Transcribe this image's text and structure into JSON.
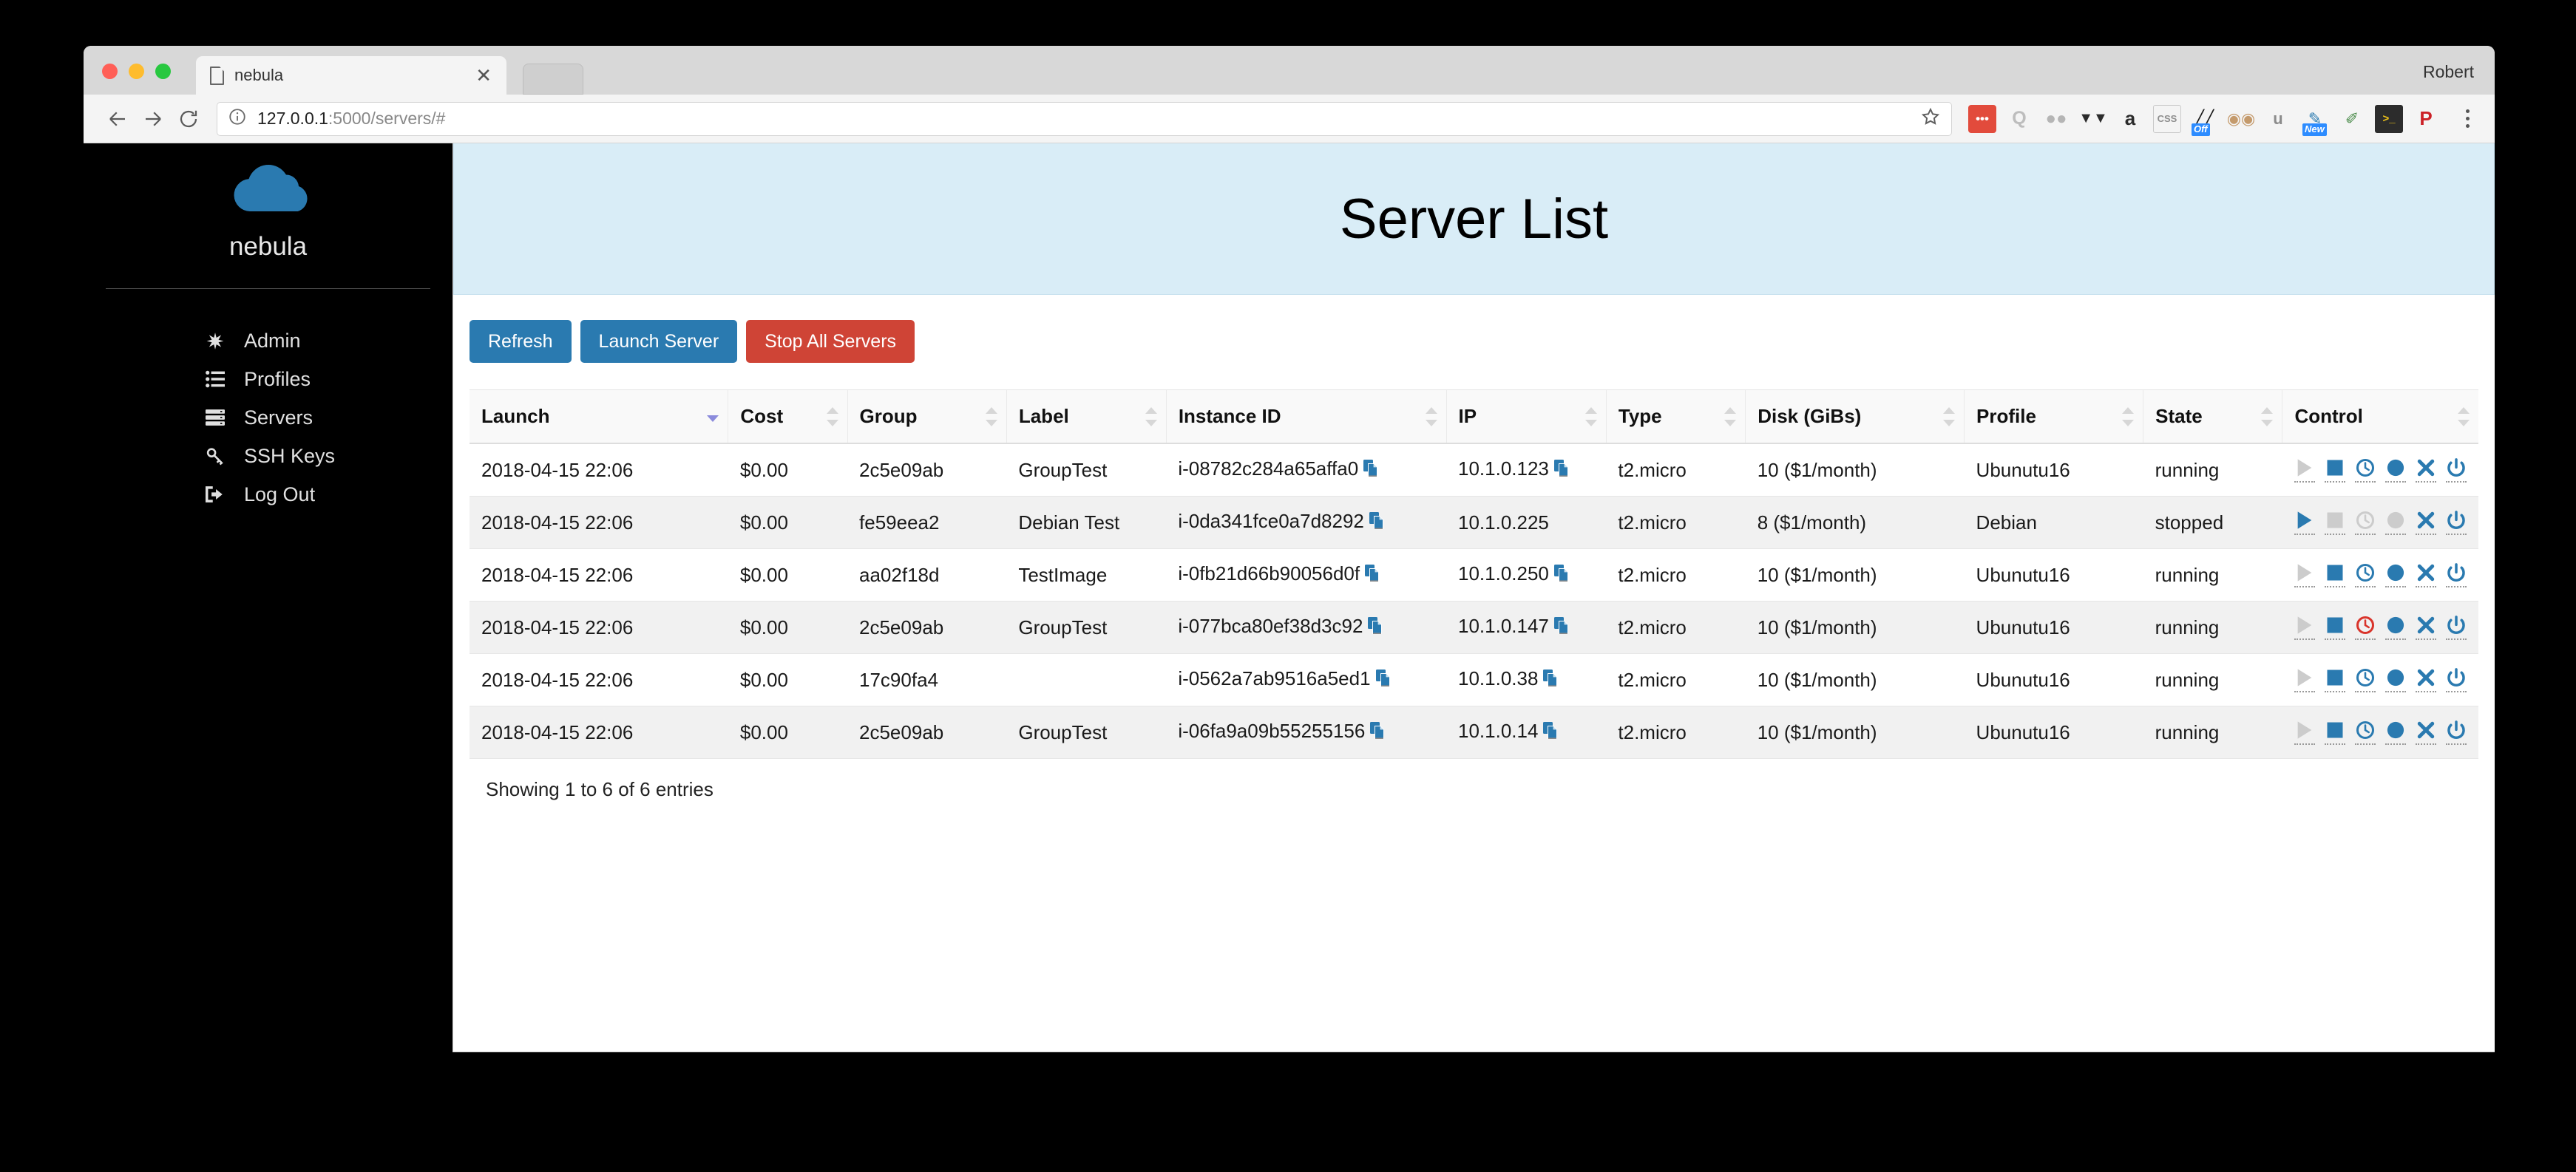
{
  "window": {
    "user_label": "Robert",
    "tab": {
      "title": "nebula",
      "favicon_icon": "document-icon",
      "close_icon": "close-icon"
    },
    "new_tab_icon": "new-tab-icon"
  },
  "toolbar": {
    "back_icon": "back-arrow-icon",
    "forward_icon": "forward-arrow-icon",
    "reload_icon": "reload-icon",
    "info_icon": "page-info-icon",
    "bookmark_icon": "star-icon",
    "menu_icon": "kebab-menu-icon",
    "url_host": "127.0.0.1",
    "url_path": ":5000/servers/#",
    "extensions": [
      {
        "name": "pocket-extension-icon",
        "glyph": "•••",
        "bg": "#e24b3c",
        "fg": "#ffffff",
        "badge": ""
      },
      {
        "name": "quantcast-extension-icon",
        "glyph": "Q",
        "bg": "transparent",
        "fg": "#bdbdbd",
        "badge": ""
      },
      {
        "name": "ghostery-extension-icon",
        "glyph": "●●",
        "bg": "transparent",
        "fg": "#b5b5b5",
        "badge": ""
      },
      {
        "name": "disconnect-extension-icon",
        "glyph": "◄►",
        "bg": "transparent",
        "fg": "#2b2b2b",
        "badge": ""
      },
      {
        "name": "amazon-extension-icon",
        "glyph": "a",
        "bg": "transparent",
        "fg": "#2b2b2b",
        "badge": ""
      },
      {
        "name": "css-extension-icon",
        "glyph": "CSS",
        "bg": "transparent",
        "fg": "#8f8f8f",
        "badge": ""
      },
      {
        "name": "script-blocker-extension-icon",
        "glyph": "╱╱",
        "bg": "transparent",
        "fg": "#1a1a1a",
        "badge": "Off"
      },
      {
        "name": "privacy-badger-extension-icon",
        "glyph": "●●",
        "bg": "transparent",
        "fg": "#c49a6c",
        "badge": ""
      },
      {
        "name": "ublock-extension-icon",
        "glyph": "u",
        "bg": "transparent",
        "fg": "#8b8b8b",
        "badge": ""
      },
      {
        "name": "evernote-extension-icon",
        "glyph": "✒",
        "bg": "transparent",
        "fg": "#2a7ab0",
        "badge": "New"
      },
      {
        "name": "colorpicker-extension-icon",
        "glyph": "✐",
        "bg": "transparent",
        "fg": "#4a8b4a",
        "badge": ""
      },
      {
        "name": "terminal-extension-icon",
        "glyph": ">_",
        "bg": "#2c2c2c",
        "fg": "#f0c419",
        "badge": ""
      },
      {
        "name": "pinterest-extension-icon",
        "glyph": "P",
        "bg": "transparent",
        "fg": "#cc2127",
        "badge": ""
      }
    ]
  },
  "sidebar": {
    "logo_icon": "cloud-logo-icon",
    "brand": "nebula",
    "items": [
      {
        "label": "Admin",
        "icon": "asterisk-icon"
      },
      {
        "label": "Profiles",
        "icon": "list-icon"
      },
      {
        "label": "Servers",
        "icon": "server-icon"
      },
      {
        "label": "SSH Keys",
        "icon": "key-icon"
      },
      {
        "label": "Log Out",
        "icon": "sign-out-icon"
      }
    ]
  },
  "main": {
    "page_title": "Server List",
    "buttons": [
      {
        "label": "Refresh",
        "style": "primary"
      },
      {
        "label": "Launch Server",
        "style": "primary"
      },
      {
        "label": "Stop All Servers",
        "style": "danger"
      }
    ],
    "table": {
      "columns": [
        {
          "label": "Launch",
          "sort": "desc"
        },
        {
          "label": "Cost",
          "sort": "none"
        },
        {
          "label": "Group",
          "sort": "none"
        },
        {
          "label": "Label",
          "sort": "none"
        },
        {
          "label": "Instance ID",
          "sort": "none"
        },
        {
          "label": "IP",
          "sort": "none"
        },
        {
          "label": "Type",
          "sort": "none"
        },
        {
          "label": "Disk (GiBs)",
          "sort": "none"
        },
        {
          "label": "Profile",
          "sort": "none"
        },
        {
          "label": "State",
          "sort": "none"
        },
        {
          "label": "Control",
          "sort": "none"
        }
      ],
      "rows": [
        {
          "launch": "2018-04-15 22:06",
          "cost": "$0.00",
          "group": "2c5e09ab",
          "label": "GroupTest",
          "instance_id": "i-08782c284a65affa0",
          "instance_copy": true,
          "ip": "10.1.0.123",
          "ip_copy": true,
          "type": "t2.micro",
          "disk": "10 ($1/month)",
          "profile": "Ubunutu16",
          "state": "running",
          "control": [
            "play-gray",
            "stop-blue",
            "clock-blue",
            "circle-blue",
            "x-blue",
            "power-blue"
          ]
        },
        {
          "launch": "2018-04-15 22:06",
          "cost": "$0.00",
          "group": "fe59eea2",
          "label": "Debian Test",
          "instance_id": "i-0da341fce0a7d8292",
          "instance_copy": true,
          "ip": "10.1.0.225",
          "ip_copy": false,
          "type": "t2.micro",
          "disk": "8 ($1/month)",
          "profile": "Debian",
          "state": "stopped",
          "control": [
            "play-blue",
            "stop-gray",
            "clock-gray",
            "circle-gray",
            "x-blue",
            "power-blue"
          ]
        },
        {
          "launch": "2018-04-15 22:06",
          "cost": "$0.00",
          "group": "aa02f18d",
          "label": "TestImage",
          "instance_id": "i-0fb21d66b90056d0f",
          "instance_copy": true,
          "ip": "10.1.0.250",
          "ip_copy": true,
          "type": "t2.micro",
          "disk": "10 ($1/month)",
          "profile": "Ubunutu16",
          "state": "running",
          "control": [
            "play-gray",
            "stop-blue",
            "clock-blue",
            "circle-blue",
            "x-blue",
            "power-blue"
          ]
        },
        {
          "launch": "2018-04-15 22:06",
          "cost": "$0.00",
          "group": "2c5e09ab",
          "label": "GroupTest",
          "instance_id": "i-077bca80ef38d3c92",
          "instance_copy": true,
          "ip": "10.1.0.147",
          "ip_copy": true,
          "type": "t2.micro",
          "disk": "10 ($1/month)",
          "profile": "Ubunutu16",
          "state": "running",
          "control": [
            "play-gray",
            "stop-blue",
            "clock-red",
            "circle-blue",
            "x-blue",
            "power-blue"
          ]
        },
        {
          "launch": "2018-04-15 22:06",
          "cost": "$0.00",
          "group": "17c90fa4",
          "label": "",
          "instance_id": "i-0562a7ab9516a5ed1",
          "instance_copy": true,
          "ip": "10.1.0.38",
          "ip_copy": true,
          "type": "t2.micro",
          "disk": "10 ($1/month)",
          "profile": "Ubunutu16",
          "state": "running",
          "control": [
            "play-gray",
            "stop-blue",
            "clock-blue",
            "circle-blue",
            "x-blue",
            "power-blue"
          ]
        },
        {
          "launch": "2018-04-15 22:06",
          "cost": "$0.00",
          "group": "2c5e09ab",
          "label": "GroupTest",
          "instance_id": "i-06fa9a09b55255156",
          "instance_copy": true,
          "ip": "10.1.0.14",
          "ip_copy": true,
          "type": "t2.micro",
          "disk": "10 ($1/month)",
          "profile": "Ubunutu16",
          "state": "running",
          "control": [
            "play-gray",
            "stop-blue",
            "clock-blue",
            "circle-blue",
            "x-blue",
            "power-blue"
          ]
        }
      ],
      "info": "Showing 1 to 6 of 6 entries"
    }
  },
  "colors": {
    "brand_blue": "#2a7ab0",
    "danger_red": "#cf4436",
    "banner_blue": "#d9edf7",
    "sidebar_bg": "#000000",
    "disabled_gray": "#cccccc",
    "alert_red": "#d9342b"
  }
}
